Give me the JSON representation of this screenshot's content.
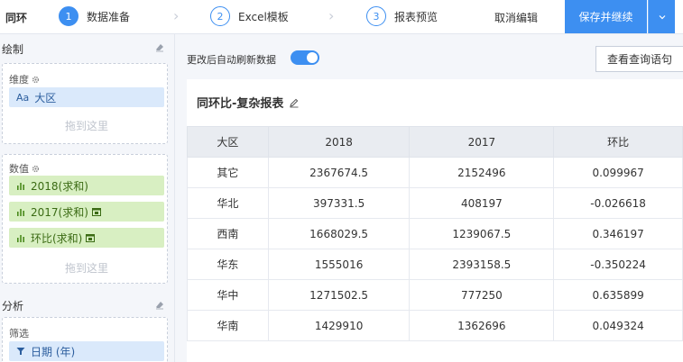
{
  "topbar": {
    "title": "同环",
    "steps": [
      {
        "num": "1",
        "label": "数据准备"
      },
      {
        "num": "2",
        "label": "Excel模板"
      },
      {
        "num": "3",
        "label": "报表预览"
      }
    ],
    "cancel_label": "取消编辑",
    "save_label": "保存并继续"
  },
  "left": {
    "draw_section": "绘制",
    "dimension_head": "维度",
    "dimension_fields": [
      {
        "icon": "Aa",
        "label": "大区"
      }
    ],
    "drop_here": "拖到这里",
    "measure_head": "数值",
    "measure_fields": [
      {
        "label": "2018(求和)"
      },
      {
        "label": "2017(求和)"
      },
      {
        "label": "环比(求和)"
      }
    ],
    "analysis_section": "分析",
    "filter_head": "筛选",
    "filter_fields": [
      {
        "label": "日期 (年)"
      }
    ]
  },
  "main": {
    "auto_refresh_label": "更改后自动刷新数据",
    "auto_refresh_on": true,
    "query_button": "查看查询语句",
    "report_title": "同环比-复杂报表",
    "table": {
      "headers": [
        "大区",
        "2018",
        "2017",
        "环比"
      ],
      "rows": [
        [
          "其它",
          "2367674.5",
          "2152496",
          "0.099967"
        ],
        [
          "华北",
          "397331.5",
          "408197",
          "-0.026618"
        ],
        [
          "西南",
          "1668029.5",
          "1239067.5",
          "0.346197"
        ],
        [
          "华东",
          "1555016",
          "2393158.5",
          "-0.350224"
        ],
        [
          "华中",
          "1271502.5",
          "777250",
          "0.635899"
        ],
        [
          "华南",
          "1429910",
          "1362696",
          "0.049324"
        ]
      ]
    }
  },
  "colors": {
    "accent": "#3d8ff1",
    "dimension_bg": "#dae9fb",
    "measure_bg": "#d8efc2"
  }
}
